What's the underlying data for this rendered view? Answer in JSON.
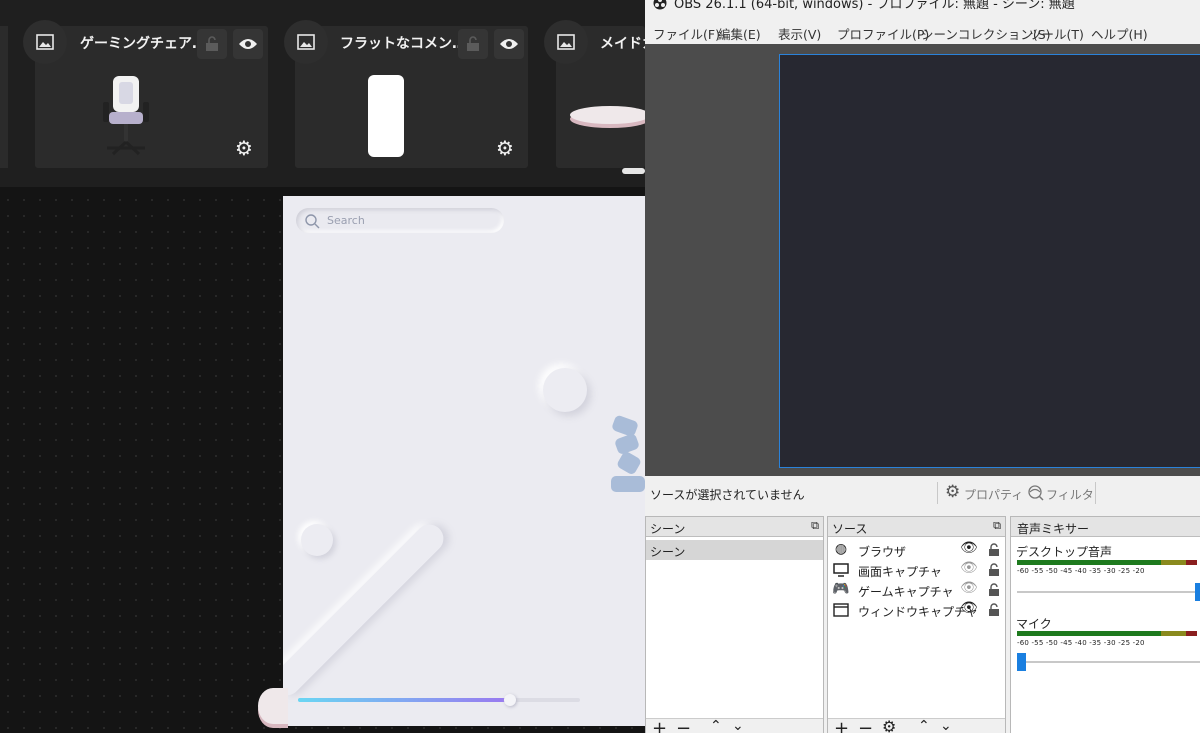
{
  "gallery": {
    "cards": [
      {
        "title": "ゲーミングチェア…"
      },
      {
        "title": "フラットなコメン…"
      },
      {
        "title": "メイドカ"
      }
    ]
  },
  "neumorphic": {
    "search_placeholder": "Search",
    "slider_value": 0.75
  },
  "obs": {
    "title": "OBS 26.1.1 (64-bit, windows) - プロファイル: 無題 - シーン: 無題",
    "menu": [
      "ファイル(F)",
      "編集(E)",
      "表示(V)",
      "プロファイル(P)",
      "シーンコレクション(S)",
      "ツール(T)",
      "ヘルプ(H)"
    ],
    "status": {
      "no_source": "ソースが選択されていません",
      "properties": "プロパティ",
      "filters": "フィルタ"
    },
    "scenes": {
      "header": "シーン",
      "items": [
        "シーン"
      ]
    },
    "sources": {
      "header": "ソース",
      "items": [
        {
          "label": "ブラウザ",
          "icon": "globe-icon",
          "visible": true
        },
        {
          "label": "画面キャプチャ",
          "icon": "monitor-icon",
          "visible": false
        },
        {
          "label": "ゲームキャプチャ",
          "icon": "gamepad-icon",
          "visible": false
        },
        {
          "label": "ウィンドウキャプチャ",
          "icon": "window-icon",
          "visible": true
        }
      ]
    },
    "mixer": {
      "header": "音声ミキサー",
      "channels": [
        {
          "name": "デスクトップ音声"
        },
        {
          "name": "マイク"
        }
      ],
      "ticks": "-60 -55 -50 -45 -40 -35 -30 -25 -20"
    }
  }
}
